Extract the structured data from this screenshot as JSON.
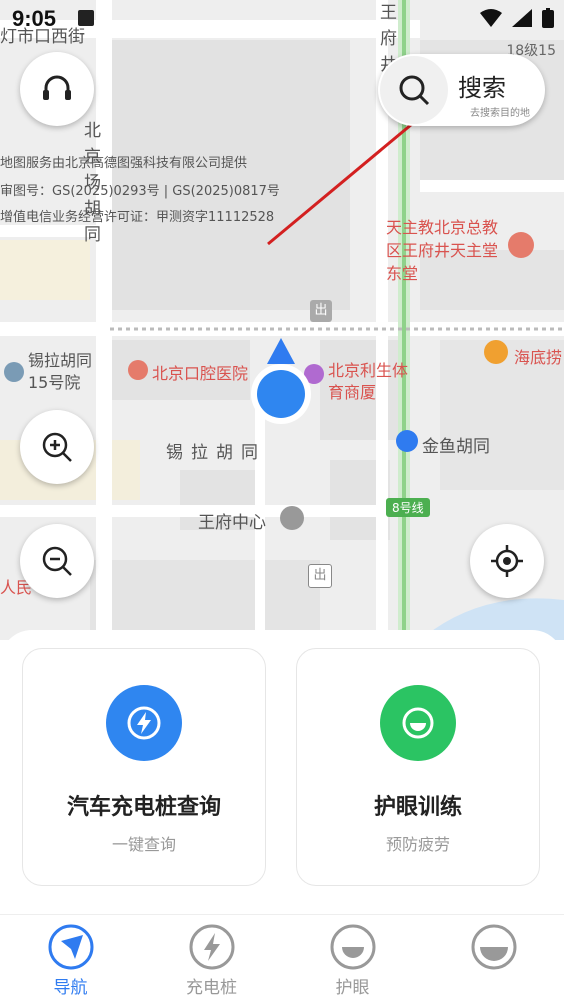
{
  "status_bar": {
    "time": "9:05"
  },
  "map": {
    "scale_text": "18级15",
    "copyright": [
      "地图服务由北京高德图强科技有限公司提供",
      "审图号：GS(2025)0293号 | GS(2025)0817号",
      "增值电信业务经营许可证：甲测资字11112528"
    ],
    "labels": {
      "street_top_left": "灯市口西街",
      "wangfujing_top": "王府井",
      "beijing_hutong": "北京场胡同",
      "church": "天主教北京总教区王府井天主堂东堂",
      "xila_15": "锡拉胡同15号院",
      "dental_hospital": "北京口腔医院",
      "lisheng": "北京利生体育商厦",
      "haidilao": "海底捞",
      "xila_hutong": "锡拉胡同",
      "jinyu_hutong": "金鱼胡同",
      "line8": "8号线",
      "wangfu_center": "王府中心",
      "left_bottom": "人民",
      "exit": "出"
    },
    "search": {
      "label": "搜索",
      "sub": "去搜索目的地"
    }
  },
  "cards": [
    {
      "title": "汽车充电桩查询",
      "sub": "一键查询",
      "color": "#2f86f0"
    },
    {
      "title": "护眼训练",
      "sub": "预防疲劳",
      "color": "#2bc463"
    }
  ],
  "nav": [
    {
      "label": "导航",
      "icon": "navigation-icon",
      "active": true
    },
    {
      "label": "充电桩",
      "icon": "charging-icon",
      "active": false
    },
    {
      "label": "护眼",
      "icon": "eye-care-icon",
      "active": false
    },
    {
      "label": "",
      "icon": "theme-icon",
      "active": false
    }
  ],
  "colors": {
    "accent": "#2f7bf0",
    "green": "#2bc463",
    "map_bg": "#efefef"
  }
}
